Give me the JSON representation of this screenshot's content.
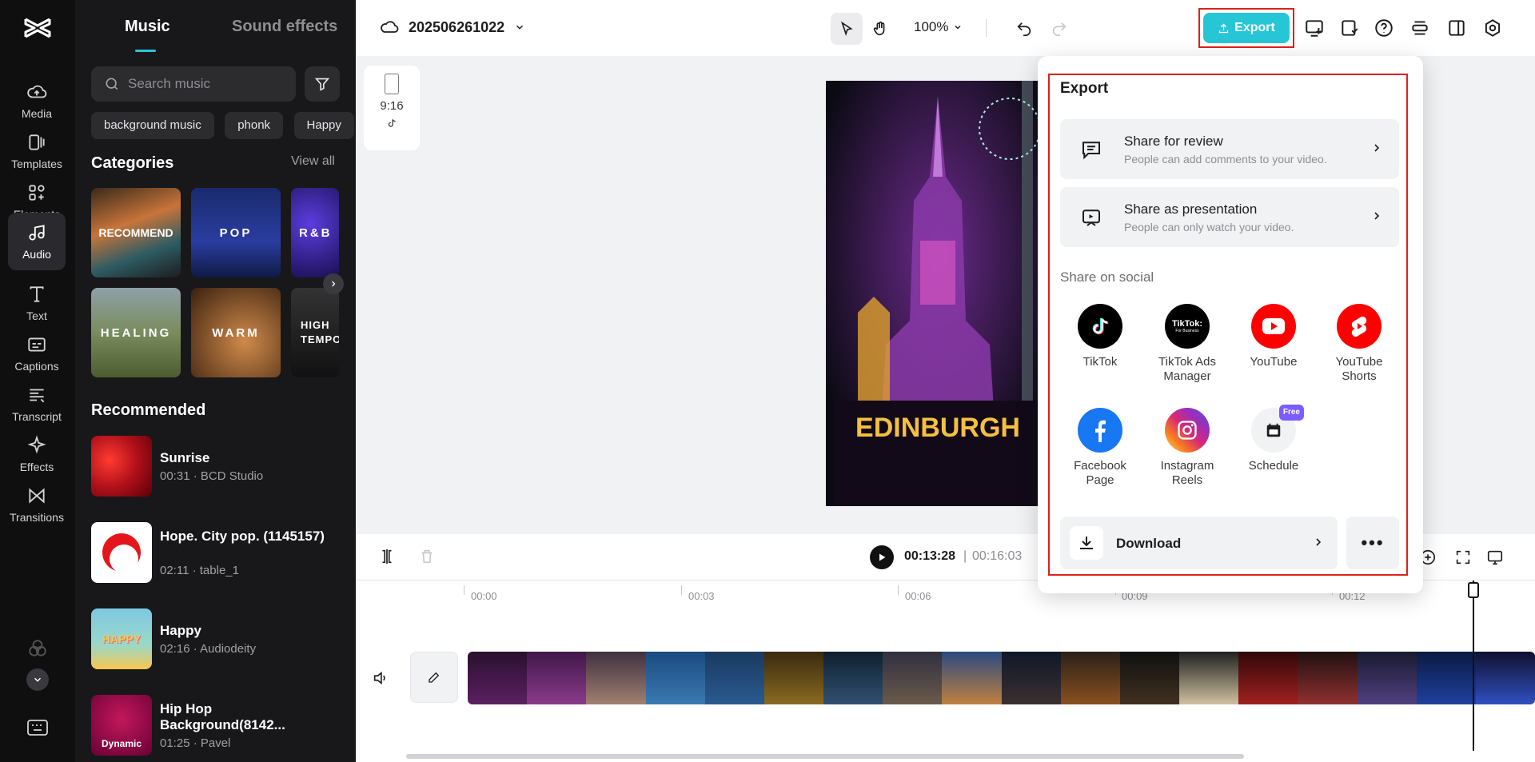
{
  "rail": {
    "items": [
      {
        "label": "Media",
        "icon": "cloud-upload-icon"
      },
      {
        "label": "Templates",
        "icon": "templates-icon"
      },
      {
        "label": "Elements",
        "icon": "elements-icon"
      },
      {
        "label": "Audio",
        "icon": "music-note-icon"
      },
      {
        "label": "Text",
        "icon": "text-icon"
      },
      {
        "label": "Captions",
        "icon": "captions-icon"
      },
      {
        "label": "Transcript",
        "icon": "transcript-icon"
      },
      {
        "label": "Effects",
        "icon": "sparkle-icon"
      },
      {
        "label": "Transitions",
        "icon": "transitions-icon"
      }
    ]
  },
  "panel": {
    "tabs": {
      "music": "Music",
      "sfx": "Sound effects"
    },
    "search_placeholder": "Search music",
    "chips": [
      "background music",
      "phonk",
      "Happy"
    ],
    "categories_title": "Categories",
    "view_all": "View all",
    "categories": [
      "RECOMMEND",
      "POP",
      "R&B",
      "HEALING",
      "WARM",
      "HIGH TEMPO"
    ],
    "recommended_title": "Recommended",
    "recommended": [
      {
        "title": "Sunrise",
        "meta": "00:31 · BCD Studio"
      },
      {
        "title": "Hope. City pop. (1145157)",
        "meta": "02:11 · table_1"
      },
      {
        "title": "Happy",
        "meta": "02:16 · Audiodeity"
      },
      {
        "title": "Hip Hop Background(8142...",
        "meta": "01:25 · Pavel"
      }
    ],
    "thumb_text": {
      "happy": "HAPPY",
      "dynamic": "Dynamic"
    }
  },
  "topbar": {
    "project_name": "202506261022",
    "zoom": "100%",
    "export_label": "Export"
  },
  "stage": {
    "ratio": "9:16",
    "video_sign": "EDINBURGH"
  },
  "playback": {
    "current": "00:13:28",
    "separator": "|",
    "total": "00:16:03"
  },
  "timeline": {
    "ruler": [
      "00:00",
      "00:03",
      "00:06",
      "00:09",
      "00:12"
    ]
  },
  "export_popover": {
    "title": "Export",
    "share_review": {
      "title": "Share for review",
      "subtitle": "People can add comments to your video."
    },
    "share_presentation": {
      "title": "Share as presentation",
      "subtitle": "People can only watch your video."
    },
    "social_label": "Share on social",
    "socials": [
      {
        "label": "TikTok",
        "icon": "tiktok-icon"
      },
      {
        "label": "TikTok Ads Manager",
        "icon": "tiktok-ads-icon"
      },
      {
        "label": "YouTube",
        "icon": "youtube-icon"
      },
      {
        "label": "YouTube Shorts",
        "icon": "youtube-shorts-icon"
      },
      {
        "label": "Facebook Page",
        "icon": "facebook-icon"
      },
      {
        "label": "Instagram Reels",
        "icon": "instagram-icon"
      },
      {
        "label": "Schedule",
        "icon": "calendar-icon"
      }
    ],
    "schedule_badge": "Free",
    "tiktok_ads_logo": {
      "line1": "TikTok:",
      "line2": "For Business"
    },
    "download_label": "Download",
    "more_label": "•••"
  },
  "colors": {
    "accent": "#26c6d6",
    "highlight": "#e0201b",
    "rail_bg": "#0f0f10",
    "panel_bg": "#18181a"
  }
}
